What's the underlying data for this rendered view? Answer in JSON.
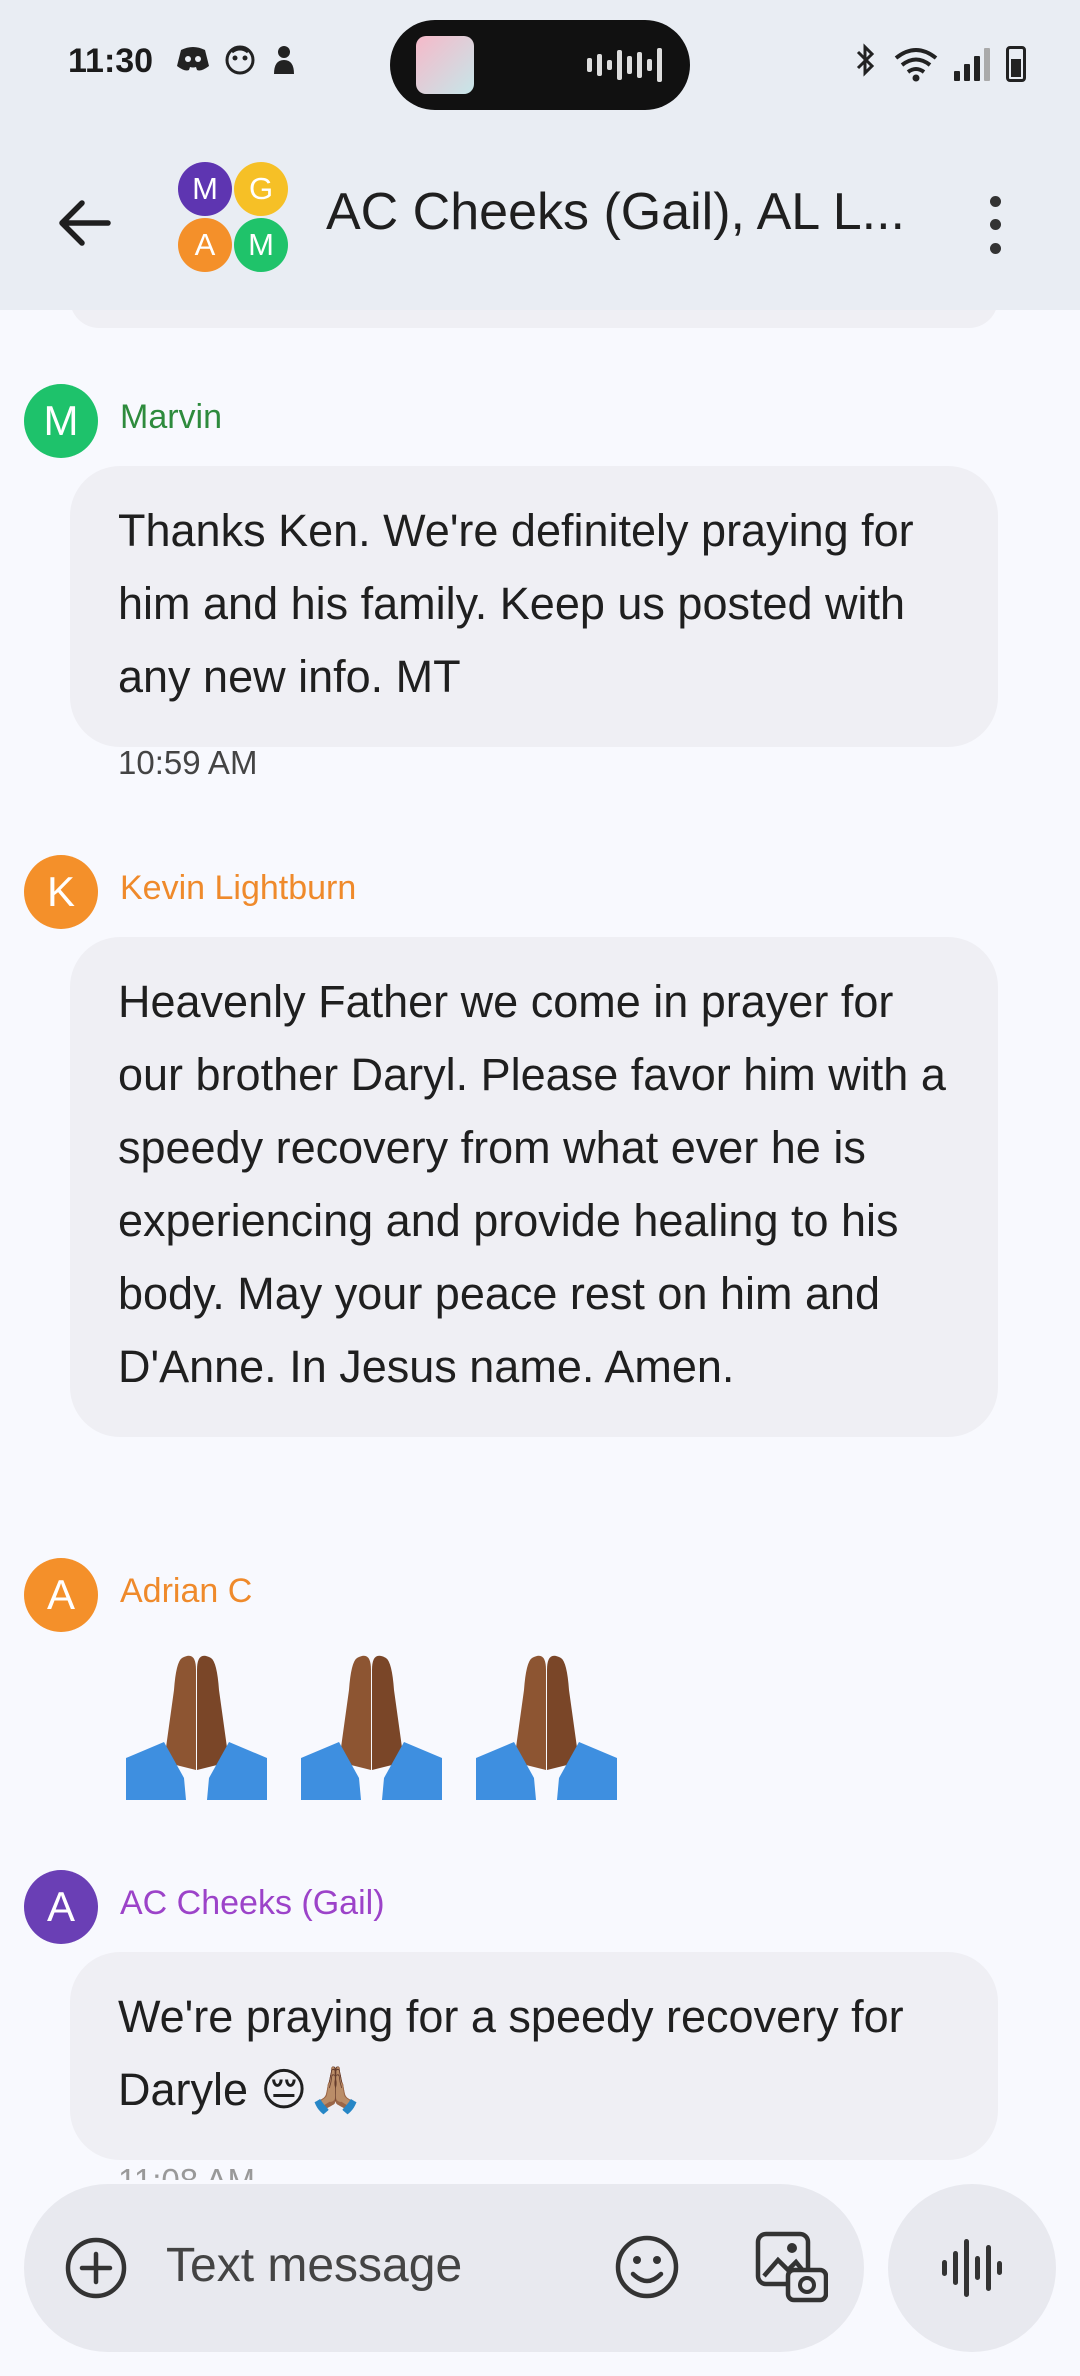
{
  "status_bar": {
    "time": "11:30",
    "left_icons": [
      "discord-icon",
      "face-icon",
      "notification-icon"
    ],
    "right_icons": [
      "bluetooth-icon",
      "wifi-icon",
      "signal-icon",
      "battery-icon"
    ]
  },
  "header": {
    "title": "AC Cheeks (Gail), AL L...",
    "group_avatars": [
      {
        "letter": "M",
        "color": "#5e35b1"
      },
      {
        "letter": "G",
        "color": "#f6c026"
      },
      {
        "letter": "A",
        "color": "#f4902a"
      },
      {
        "letter": "M",
        "color": "#1fc36a"
      }
    ]
  },
  "messages": [
    {
      "sender": "Marvin",
      "avatar_letter": "M",
      "avatar_color": "#1ec26b",
      "name_color": "#2e8b3d",
      "text": "Thanks Ken. We're definitely praying for him and his family. Keep us posted with any new info. MT",
      "time": "10:59 AM"
    },
    {
      "sender": "Kevin Lightburn",
      "avatar_letter": "K",
      "avatar_color": "#f4902a",
      "name_color": "#ef8a2b",
      "text": "Heavenly Father we come in prayer for our brother Daryl. Please favor him with a speedy recovery from what ever he is experiencing and provide healing to his body. May your peace rest on him and D'Anne. In Jesus name. Amen."
    },
    {
      "sender": "Adrian C",
      "avatar_letter": "A",
      "avatar_color": "#f4902a",
      "name_color": "#ef8a2b",
      "emoji": [
        "folded-hands-emoji",
        "folded-hands-emoji",
        "folded-hands-emoji"
      ]
    },
    {
      "sender": "AC Cheeks (Gail)",
      "avatar_letter": "A",
      "avatar_color": "#6a3fb5",
      "name_color": "#9c43c9",
      "text": "We're praying for a speedy recovery for Daryle 😔🙏🏽",
      "time": "11:08 AM"
    }
  ],
  "composer": {
    "placeholder": "Text message"
  }
}
